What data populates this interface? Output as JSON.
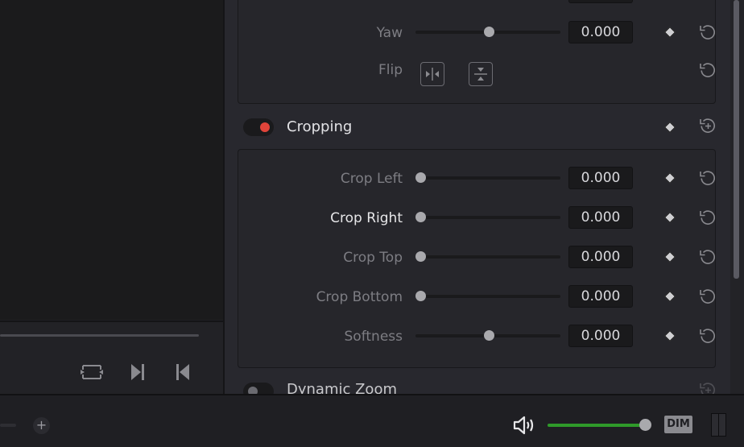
{
  "inspector": {
    "top_partial_row": {
      "value": ""
    },
    "transform_rows": [
      {
        "id": "yaw",
        "label": "Yaw",
        "value": "0.000",
        "slider_position": 0.5
      }
    ],
    "flip": {
      "label": "Flip",
      "buttons": [
        {
          "id": "flip-horizontal",
          "icon": "flip-horizontal-icon"
        },
        {
          "id": "flip-vertical",
          "icon": "flip-vertical-icon"
        }
      ]
    },
    "cropping": {
      "title": "Cropping",
      "enabled": true,
      "toggle_color": "#e0443a",
      "rows": [
        {
          "id": "crop-left",
          "label": "Crop Left",
          "value": "0.000",
          "slider_position": 0.0,
          "active": false
        },
        {
          "id": "crop-right",
          "label": "Crop Right",
          "value": "0.000",
          "slider_position": 0.0,
          "active": true
        },
        {
          "id": "crop-top",
          "label": "Crop Top",
          "value": "0.000",
          "slider_position": 0.0,
          "active": false
        },
        {
          "id": "crop-bottom",
          "label": "Crop Bottom",
          "value": "0.000",
          "slider_position": 0.0,
          "active": false
        },
        {
          "id": "softness",
          "label": "Softness",
          "value": "0.000",
          "slider_position": 0.5,
          "active": false
        }
      ]
    },
    "dynamic_zoom": {
      "title": "Dynamic Zoom",
      "enabled": false
    }
  },
  "transport": {
    "buttons": [
      {
        "id": "loop",
        "icon": "loop-icon"
      },
      {
        "id": "next-frame",
        "icon": "skip-to-end-icon"
      },
      {
        "id": "prev-frame",
        "icon": "skip-to-start-icon"
      }
    ]
  },
  "bottombar": {
    "zoom_in_label": "+",
    "volume_level": 1.0,
    "volume_color": "#2f9a2a",
    "dim_label": "DIM"
  }
}
